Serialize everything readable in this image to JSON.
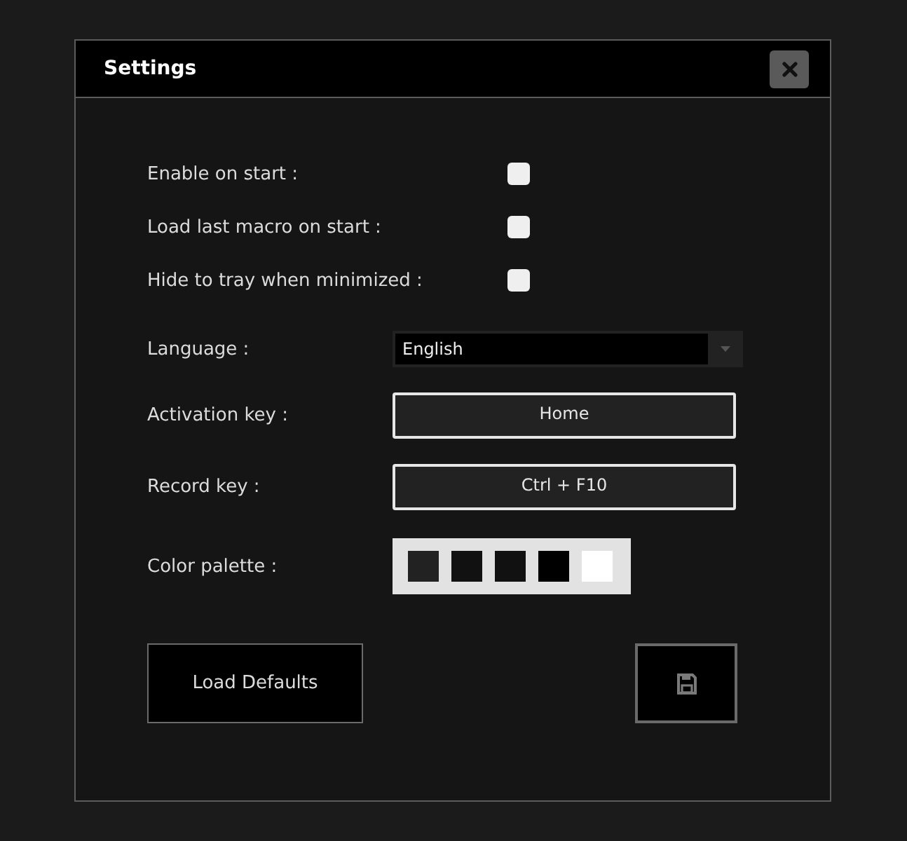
{
  "window": {
    "title": "Settings"
  },
  "options": [
    {
      "kind": "checkbox",
      "label": "Enable on start :",
      "checked": false
    },
    {
      "kind": "checkbox",
      "label": "Load last macro on start :",
      "checked": false
    },
    {
      "kind": "checkbox",
      "label": "Hide to tray when minimized :",
      "checked": false
    },
    {
      "kind": "dropdown",
      "label": "Language :",
      "value": "English"
    },
    {
      "kind": "key",
      "label": "Activation key :",
      "value": "Home"
    },
    {
      "kind": "key",
      "label": "Record key :",
      "value": "Ctrl + F10"
    },
    {
      "kind": "palette",
      "label": "Color palette :",
      "swatches": [
        {
          "color": "#222222"
        },
        {
          "color": "#111111"
        },
        {
          "color": "#111111"
        },
        {
          "color": "#000000"
        },
        {
          "color": "#ffffff"
        }
      ]
    }
  ],
  "buttons": [
    {
      "kind": "text",
      "label": "Load Defaults"
    },
    {
      "kind": "save"
    }
  ]
}
